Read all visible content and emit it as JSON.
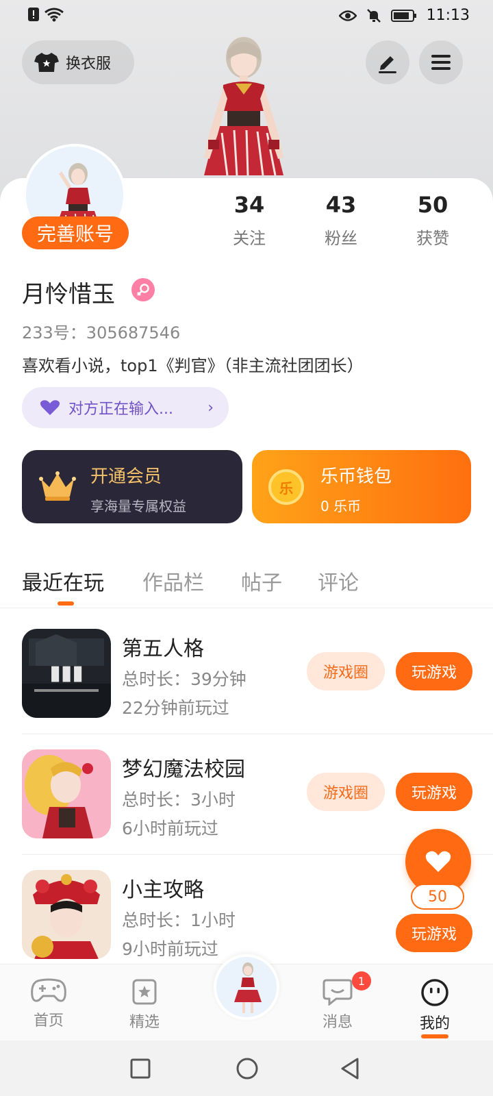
{
  "status_bar": {
    "time": "11:13"
  },
  "header": {
    "outfit_button_label": "换衣服"
  },
  "profile": {
    "complete_account_label": "完善账号",
    "stats": [
      {
        "value": "34",
        "label": "关注"
      },
      {
        "value": "43",
        "label": "粉丝"
      },
      {
        "value": "50",
        "label": "获赞"
      }
    ],
    "username": "月怜惜玉",
    "uid": "233号：305687546",
    "bio": "喜欢看小说，top1《判官》（非主流社团团长）",
    "typing_status": "对方正在输入..."
  },
  "vip": {
    "title": "开通会员",
    "subtitle": "享海量专属权益"
  },
  "wallet": {
    "title": "乐币钱包",
    "subtitle": "0 乐币",
    "coin_glyph": "乐"
  },
  "tabs": [
    {
      "label": "最近在玩",
      "active": true
    },
    {
      "label": "作品栏",
      "active": false
    },
    {
      "label": "帖子",
      "active": false
    },
    {
      "label": "评论",
      "active": false
    }
  ],
  "games": [
    {
      "name": "第五人格",
      "duration": "总时长：39分钟",
      "last_played": "22分钟前玩过",
      "circle_label": "游戏圈",
      "play_label": "玩游戏"
    },
    {
      "name": "梦幻魔法校园",
      "duration": "总时长：3小时",
      "last_played": "6小时前玩过",
      "circle_label": "游戏圈",
      "play_label": "玩游戏"
    },
    {
      "name": "小主攻略",
      "duration": "总时长：1小时",
      "last_played": "9小时前玩过",
      "play_label": "玩游戏"
    }
  ],
  "like_fab": {
    "count": "50"
  },
  "bottom_nav": [
    {
      "label": "首页"
    },
    {
      "label": "精选"
    },
    {
      "label": "消息",
      "badge": "1"
    },
    {
      "label": "我的",
      "active": true
    }
  ],
  "colors": {
    "accent": "#ff6a13",
    "vip_bg": "#2a2738",
    "typing_bg": "#eeeaf9",
    "typing_text": "#6f52c6"
  }
}
